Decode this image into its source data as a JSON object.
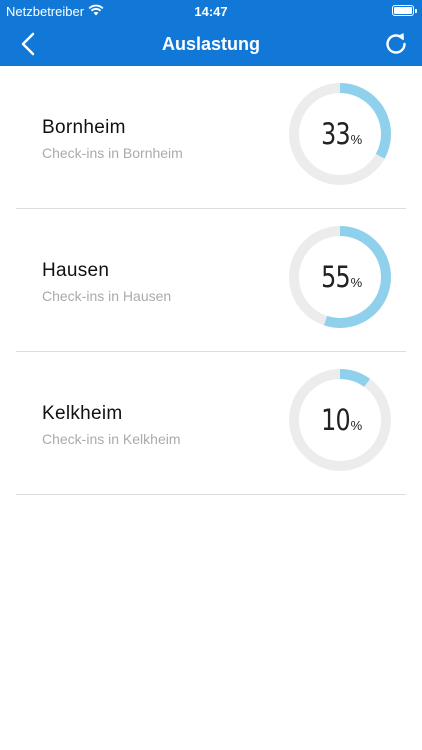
{
  "status_bar": {
    "carrier": "Netzbetreiber",
    "time": "14:47"
  },
  "nav": {
    "title": "Auslastung",
    "back_icon": "chevron-left-icon",
    "refresh_icon": "refresh-icon"
  },
  "colors": {
    "primary": "#1178d8",
    "gauge_fill": "#8fd0ec",
    "gauge_track": "#ececec"
  },
  "locations": [
    {
      "name": "Bornheim",
      "subtitle": "Check-ins in Bornheim",
      "percent": 33,
      "unit": "%"
    },
    {
      "name": "Hausen",
      "subtitle": "Check-ins in Hausen",
      "percent": 55,
      "unit": "%"
    },
    {
      "name": "Kelkheim",
      "subtitle": "Check-ins in Kelkheim",
      "percent": 10,
      "unit": "%"
    }
  ]
}
